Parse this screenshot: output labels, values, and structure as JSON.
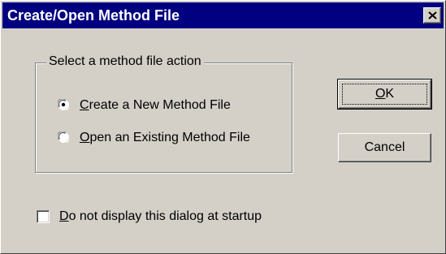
{
  "window": {
    "title": "Create/Open Method File",
    "close_icon": "close-icon"
  },
  "group": {
    "legend": "Select a method file action",
    "options": [
      {
        "mnemonic": "C",
        "rest": "reate a New Method File",
        "selected": true
      },
      {
        "mnemonic": "O",
        "rest": "pen an Existing Method File",
        "selected": false
      }
    ]
  },
  "checkbox": {
    "mnemonic": "D",
    "rest": "o not display this dialog at startup",
    "checked": false
  },
  "buttons": {
    "ok": {
      "mnemonic": "O",
      "rest": "K"
    },
    "cancel": {
      "label": "Cancel"
    }
  },
  "colors": {
    "titlebar": "#000080",
    "face": "#d4d0c8"
  }
}
